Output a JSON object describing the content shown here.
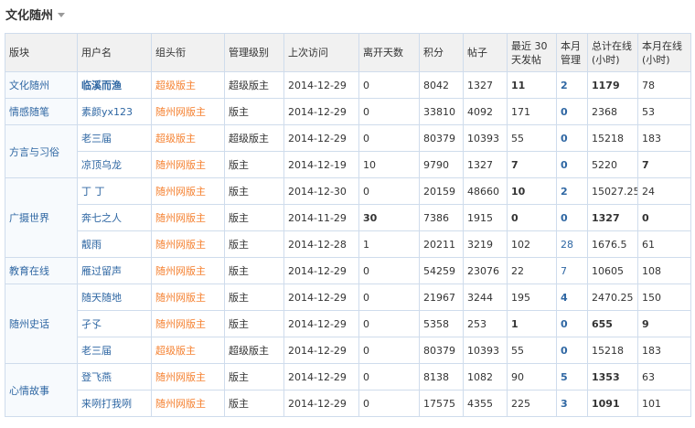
{
  "section": {
    "title": "文化随州"
  },
  "table": {
    "headers": [
      "版块",
      "用户名",
      "组头衔",
      "管理级别",
      "上次访问",
      "离开天数",
      "积分",
      "帖子",
      "最近 30 天发帖",
      "本月管理",
      "总计在线(小时)",
      "本月在线(小时)"
    ],
    "rows": [
      {
        "board": "文化随州",
        "user": "临溪而渔",
        "group": "超级版主",
        "level": "超级版主",
        "last_visit": "2014-12-29",
        "days_away": "0",
        "points": "8042",
        "posts": "1327",
        "recent30": "11",
        "month_manage": "2",
        "total_online": "1179",
        "month_online": "78"
      },
      {
        "board": "情感随笔",
        "user": "素颜yx123",
        "group": "随州网版主",
        "level": "版主",
        "last_visit": "2014-12-29",
        "days_away": "0",
        "points": "33810",
        "posts": "4092",
        "recent30": "171",
        "month_manage": "0",
        "total_online": "2368",
        "month_online": "53"
      },
      {
        "board": "方言与习俗",
        "user": "老三届",
        "group": "超级版主",
        "level": "超级版主",
        "last_visit": "2014-12-29",
        "days_away": "0",
        "points": "80379",
        "posts": "10393",
        "recent30": "55",
        "month_manage": "0",
        "total_online": "15218",
        "month_online": "183"
      },
      {
        "board": "",
        "user": "凉顶乌龙",
        "group": "随州网版主",
        "level": "版主",
        "last_visit": "2014-12-19",
        "days_away": "10",
        "points": "9790",
        "posts": "1327",
        "recent30": "7",
        "month_manage": "0",
        "total_online": "5220",
        "month_online": "7"
      },
      {
        "board": "广摄世界",
        "user": "丁 丁",
        "group": "随州网版主",
        "level": "版主",
        "last_visit": "2014-12-30",
        "days_away": "0",
        "points": "20159",
        "posts": "48660",
        "recent30": "10",
        "month_manage": "2",
        "total_online": "15027.25",
        "month_online": "24"
      },
      {
        "board": "",
        "user": "奔七之人",
        "group": "随州网版主",
        "level": "版主",
        "last_visit": "2014-11-29",
        "days_away": "30",
        "points": "7386",
        "posts": "1915",
        "recent30": "0",
        "month_manage": "0",
        "total_online": "1327",
        "month_online": "0"
      },
      {
        "board": "",
        "user": "靓雨",
        "group": "随州网版主",
        "level": "版主",
        "last_visit": "2014-12-28",
        "days_away": "1",
        "points": "20211",
        "posts": "3219",
        "recent30": "102",
        "month_manage": "28",
        "total_online": "1676.5",
        "month_online": "61"
      },
      {
        "board": "教育在线",
        "user": "雁过留声",
        "group": "随州网版主",
        "level": "版主",
        "last_visit": "2014-12-29",
        "days_away": "0",
        "points": "54259",
        "posts": "23076",
        "recent30": "22",
        "month_manage": "7",
        "total_online": "10605",
        "month_online": "108"
      },
      {
        "board": "随州史话",
        "user": "随天随地",
        "group": "随州网版主",
        "level": "版主",
        "last_visit": "2014-12-29",
        "days_away": "0",
        "points": "21967",
        "posts": "3244",
        "recent30": "195",
        "month_manage": "4",
        "total_online": "2470.25",
        "month_online": "150"
      },
      {
        "board": "",
        "user": "孑孓",
        "group": "随州网版主",
        "level": "版主",
        "last_visit": "2014-12-29",
        "days_away": "0",
        "points": "5358",
        "posts": "253",
        "recent30": "1",
        "month_manage": "0",
        "total_online": "655",
        "month_online": "9"
      },
      {
        "board": "",
        "user": "老三届",
        "group": "超级版主",
        "level": "超级版主",
        "last_visit": "2014-12-29",
        "days_away": "0",
        "points": "80379",
        "posts": "10393",
        "recent30": "55",
        "month_manage": "0",
        "total_online": "15218",
        "month_online": "183"
      },
      {
        "board": "心情故事",
        "user": "登飞燕",
        "group": "随州网版主",
        "level": "版主",
        "last_visit": "2014-12-29",
        "days_away": "0",
        "points": "8138",
        "posts": "1082",
        "recent30": "90",
        "month_manage": "5",
        "total_online": "1353",
        "month_online": "63"
      },
      {
        "board": "",
        "user": "来咧打我咧",
        "group": "随州网版主",
        "level": "版主",
        "last_visit": "2014-12-29",
        "days_away": "0",
        "points": "17575",
        "posts": "4355",
        "recent30": "225",
        "month_manage": "3",
        "total_online": "1091",
        "month_online": "101"
      }
    ]
  },
  "colors": {
    "link": "#2f67a3",
    "group_title": "#f58232",
    "border": "#cfdcec",
    "header_bg": "#f1f1f1",
    "board_bg": "#f7fafd"
  }
}
